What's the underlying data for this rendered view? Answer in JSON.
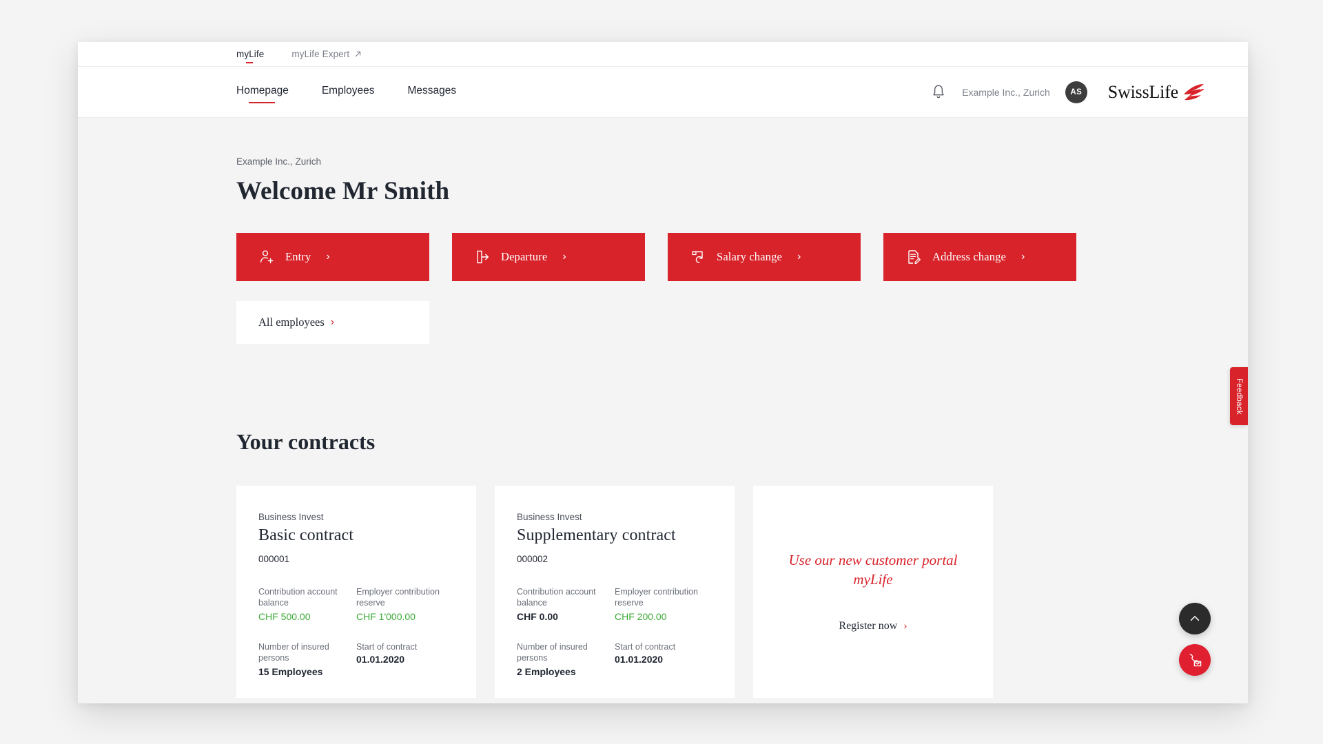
{
  "utility_bar": {
    "links": [
      {
        "label": "myLife",
        "active": true
      },
      {
        "label": "myLife Expert",
        "active": false,
        "icon": "arrow-up-right-icon"
      }
    ]
  },
  "header": {
    "nav": [
      {
        "label": "Homepage",
        "active": true
      },
      {
        "label": "Employees",
        "active": false
      },
      {
        "label": "Messages",
        "active": false
      }
    ],
    "notification_icon": "bell-icon",
    "organisation": "Example Inc., Zurich",
    "avatar_initials": "AS",
    "brand": "SwissLife",
    "brand_logo_icon": "swisslife-bird-logo-icon",
    "brand_color": "#d8232a"
  },
  "welcome": {
    "organisation": "Example Inc., Zurich",
    "title": "Welcome Mr Smith"
  },
  "actions": {
    "tiles": [
      {
        "label": "Entry",
        "icon": "person-add-icon",
        "chevron": "›"
      },
      {
        "label": "Departure",
        "icon": "exit-door-icon",
        "chevron": "›"
      },
      {
        "label": "Salary change",
        "icon": "salary-refresh-icon",
        "chevron": "›"
      },
      {
        "label": "Address change",
        "icon": "document-edit-icon",
        "chevron": "›"
      }
    ],
    "secondary": {
      "label": "All employees",
      "chevron": "›"
    }
  },
  "contracts": {
    "heading": "Your contracts",
    "cards": [
      {
        "kicker": "Business Invest",
        "title": "Basic contract",
        "number": "000001",
        "metrics": [
          {
            "label": "Contribution account balance",
            "value": "CHF 500.00",
            "style": "green"
          },
          {
            "label": "Employer contribution reserve",
            "value": "CHF 1'000.00",
            "style": "green"
          },
          {
            "label": "Number of insured persons",
            "value": "15 Employees",
            "style": "bold"
          },
          {
            "label": "Start of contract",
            "value": "01.01.2020",
            "style": "dark"
          }
        ]
      },
      {
        "kicker": "Business Invest",
        "title": "Supplementary contract",
        "number": "000002",
        "metrics": [
          {
            "label": "Contribution account balance",
            "value": "CHF 0.00",
            "style": "dark"
          },
          {
            "label": "Employer contribution reserve",
            "value": "CHF 200.00",
            "style": "green"
          },
          {
            "label": "Number of insured persons",
            "value": "2 Employees",
            "style": "bold"
          },
          {
            "label": "Start of contract",
            "value": "01.01.2020",
            "style": "dark"
          }
        ]
      }
    ],
    "promo": {
      "line1": "Use our new customer portal",
      "line2": "myLife",
      "link_label": "Register now",
      "link_chevron": "›"
    }
  },
  "feedback": {
    "label": "Feedback"
  },
  "floating": {
    "scroll_top_icon": "chevron-up-icon",
    "contact_icon": "phone-mail-icon"
  },
  "colors": {
    "brand_red": "#d8232a",
    "value_green": "#3aaa35",
    "page_bg": "#f4f4f4"
  }
}
